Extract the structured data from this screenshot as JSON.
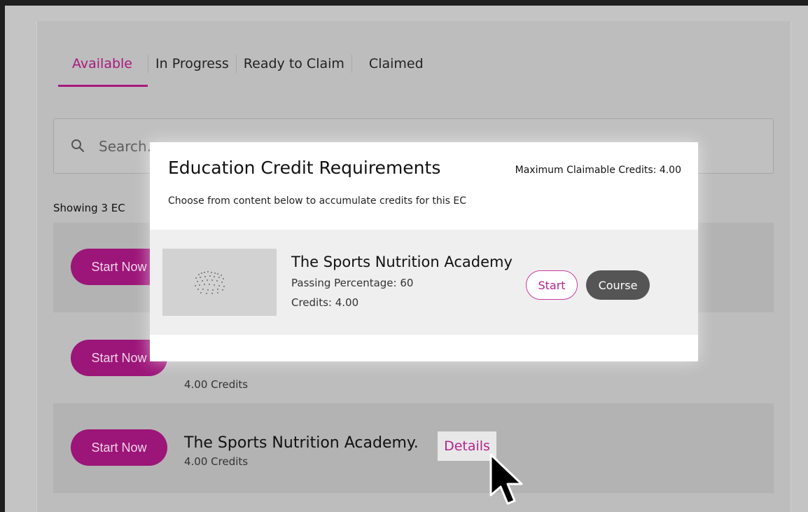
{
  "tabs": [
    {
      "label": "Available",
      "active": true
    },
    {
      "label": "In Progress",
      "active": false
    },
    {
      "label": "Ready to Claim",
      "active": false
    },
    {
      "label": "Claimed",
      "active": false
    }
  ],
  "search": {
    "placeholder": "Search..."
  },
  "showing_text": "Showing 3 EC",
  "rows": [
    {
      "button": "Start Now",
      "title": "",
      "credits": ""
    },
    {
      "button": "Start Now",
      "title": "",
      "credits": "4.00 Credits"
    },
    {
      "button": "Start Now",
      "title": "The Sports Nutrition Academy.",
      "credits": "4.00 Credits",
      "details": "Details"
    }
  ],
  "modal": {
    "title": "Education Credit Requirements",
    "max_credits": "Maximum Claimable Credits: 4.00",
    "subtitle": "Choose from content below to accumulate credits for this EC",
    "course": {
      "title": "The Sports Nutrition Academy",
      "passing": "Passing Percentage: 60",
      "credits": "Credits: 4.00",
      "start_label": "Start",
      "course_label": "Course"
    }
  },
  "colors": {
    "accent": "#a8187f",
    "button_bg": "#9c1579",
    "overlay": "#c4c4c4",
    "course_btn": "#555555"
  }
}
